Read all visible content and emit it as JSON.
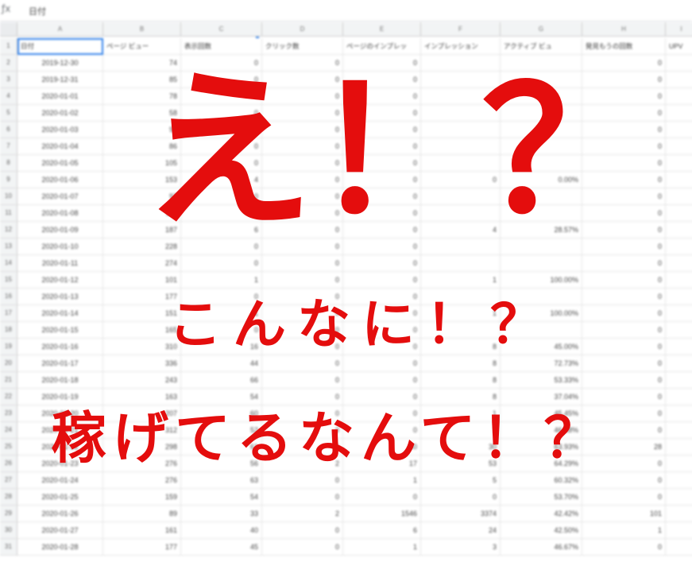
{
  "formula_bar": {
    "fx_icon": "function-icon",
    "text": "日付"
  },
  "column_letters": [
    "A",
    "B",
    "C",
    "D",
    "E",
    "F",
    "G",
    "H",
    "I"
  ],
  "table": {
    "headers": [
      "日付",
      "ページ ビュー",
      "表示回数",
      "クリック数",
      "ページのインプレッ",
      "インプレッション",
      "アクティブ ビュ",
      "発見もうの回数",
      "UPV"
    ],
    "rows": [
      [
        "2019-12-30",
        "74",
        "0",
        "0",
        "0",
        "",
        "",
        "0"
      ],
      [
        "2019-12-31",
        "85",
        "0",
        "0",
        "0",
        "",
        "",
        "0"
      ],
      [
        "2020-01-01",
        "78",
        "0",
        "0",
        "0",
        "",
        "",
        "0"
      ],
      [
        "2020-01-02",
        "58",
        "0",
        "0",
        "0",
        "",
        "",
        "0"
      ],
      [
        "2020-01-03",
        "92",
        "0",
        "0",
        "0",
        "",
        "",
        "0"
      ],
      [
        "2020-01-04",
        "86",
        "0",
        "0",
        "0",
        "",
        "",
        "0"
      ],
      [
        "2020-01-05",
        "105",
        "0",
        "0",
        "0",
        "",
        "",
        "0"
      ],
      [
        "2020-01-06",
        "153",
        "4",
        "0",
        "0",
        "0",
        "0.00%",
        "0"
      ],
      [
        "2020-01-07",
        "97",
        "0",
        "0",
        "0",
        "",
        "",
        "0"
      ],
      [
        "2020-01-08",
        "110",
        "0",
        "0",
        "0",
        "",
        "",
        "0"
      ],
      [
        "2020-01-09",
        "187",
        "6",
        "0",
        "0",
        "4",
        "28.57%",
        "0"
      ],
      [
        "2020-01-10",
        "228",
        "0",
        "0",
        "0",
        "",
        "",
        "0"
      ],
      [
        "2020-01-11",
        "274",
        "0",
        "0",
        "0",
        "",
        "",
        "0"
      ],
      [
        "2020-01-12",
        "101",
        "1",
        "0",
        "0",
        "1",
        "100.00%",
        "0"
      ],
      [
        "2020-01-13",
        "177",
        "0",
        "0",
        "0",
        "",
        "",
        "0"
      ],
      [
        "2020-01-14",
        "151",
        "1",
        "0",
        "0",
        "1",
        "100.00%",
        "0"
      ],
      [
        "2020-01-15",
        "165",
        "0",
        "0",
        "0",
        "",
        "",
        "0"
      ],
      [
        "2020-01-16",
        "310",
        "16",
        "0",
        "0",
        "8",
        "45.00%",
        "0"
      ],
      [
        "2020-01-17",
        "336",
        "44",
        "0",
        "0",
        "8",
        "72.73%",
        "0"
      ],
      [
        "2020-01-18",
        "243",
        "66",
        "0",
        "0",
        "8",
        "53.33%",
        "0"
      ],
      [
        "2020-01-19",
        "163",
        "54",
        "0",
        "0",
        "8",
        "37.04%",
        "0"
      ],
      [
        "2020-01-20",
        "207",
        "60",
        "0",
        "0",
        "1",
        "45.45%",
        "0"
      ],
      [
        "2020-01-21",
        "312",
        "52",
        "0",
        "0",
        "1",
        "46.88%",
        "0"
      ],
      [
        "2020-01-22",
        "298",
        "61",
        "0",
        "30",
        "30",
        "63.93%",
        "28"
      ],
      [
        "2020-01-23",
        "276",
        "56",
        "2",
        "17",
        "53",
        "64.29%",
        "0"
      ],
      [
        "2020-01-24",
        "276",
        "63",
        "0",
        "1",
        "5",
        "60.32%",
        "0"
      ],
      [
        "2020-01-25",
        "159",
        "54",
        "0",
        "0",
        "0",
        "53.70%",
        "0"
      ],
      [
        "2020-01-26",
        "89",
        "33",
        "2",
        "1546",
        "3374",
        "42.42%",
        "101"
      ],
      [
        "2020-01-27",
        "161",
        "40",
        "0",
        "6",
        "24",
        "42.50%",
        "1"
      ],
      [
        "2020-01-28",
        "177",
        "45",
        "0",
        "1",
        "3",
        "46.67%",
        "0"
      ]
    ]
  },
  "overlay": {
    "line1": "え！？",
    "line2": "こんなに！？",
    "line3": "稼げてるなんて！？"
  }
}
